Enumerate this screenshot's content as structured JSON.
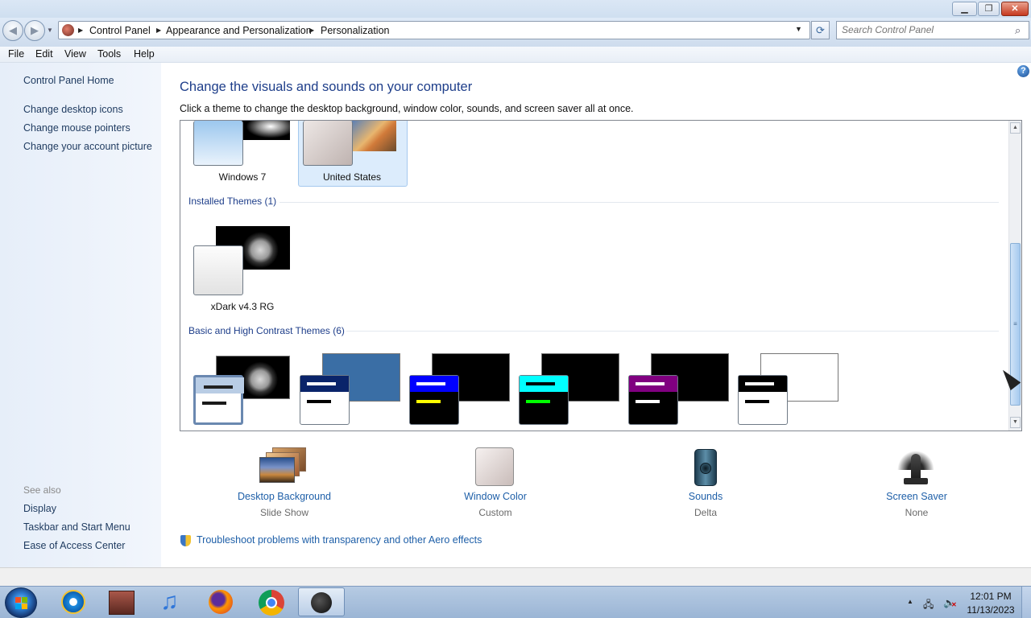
{
  "window": {
    "minimize_icon": "minimize-icon",
    "maximize_icon": "restore-icon",
    "close_glyph": "✕",
    "minimize_glyph": "▁",
    "restore_glyph": "❐"
  },
  "nav": {
    "back_glyph": "◀",
    "forward_glyph": "▶",
    "breadcrumbs": [
      "Control Panel",
      "Appearance and Personalization",
      "Personalization"
    ],
    "refresh_glyph": "⟳",
    "search_placeholder": "Search Control Panel",
    "search_glyph": "⌕"
  },
  "menu": [
    "File",
    "Edit",
    "View",
    "Tools",
    "Help"
  ],
  "left_pane": {
    "home": "Control Panel Home",
    "links": [
      "Change desktop icons",
      "Change mouse pointers",
      "Change your account picture"
    ],
    "see_also_label": "See also",
    "see_also": [
      "Display",
      "Taskbar and Start Menu",
      "Ease of Access Center"
    ]
  },
  "main": {
    "heading": "Change the visuals and sounds on your computer",
    "subtitle": "Click a theme to change the desktop background, window color, sounds, and screen saver all at once.",
    "help_glyph": "?",
    "aero_themes": [
      {
        "name": "Windows 7"
      },
      {
        "name": "United States",
        "selected": true
      }
    ],
    "installed_header": "Installed Themes (1)",
    "installed_themes": [
      {
        "name": "xDark v4.3 RG"
      }
    ],
    "basic_header": "Basic and High Contrast Themes (6)",
    "basic_themes": [
      {
        "big": "#000000",
        "small": "#b9cde5",
        "bar1": "#1a1a1a",
        "bar2": "#1a1a1a"
      },
      {
        "big": "#3a6ea5",
        "small": "#ffffff",
        "bar1": "#0a246a",
        "bar2": "#000000"
      },
      {
        "big": "#000000",
        "small": "#000000",
        "bar1": "#0000ff",
        "bar2": "#ffff00"
      },
      {
        "big": "#000000",
        "small": "#000000",
        "bar1": "#00ffff",
        "bar2": "#00ff00"
      },
      {
        "big": "#000000",
        "small": "#000000",
        "bar1": "#800080",
        "bar2": "#ffffff"
      },
      {
        "big": "#ffffff",
        "small": "#ffffff",
        "bar1": "#000000",
        "bar2": "#000000"
      }
    ],
    "tiles": [
      {
        "label": "Desktop Background",
        "sub": "Slide Show",
        "icon": "desktop-background-icon"
      },
      {
        "label": "Window Color",
        "sub": "Custom",
        "icon": "window-color-icon"
      },
      {
        "label": "Sounds",
        "sub": "Delta",
        "icon": "sounds-icon"
      },
      {
        "label": "Screen Saver",
        "sub": "None",
        "icon": "screen-saver-icon"
      }
    ],
    "trouble_link": "Troubleshoot problems with transparency and other Aero effects"
  },
  "taskbar": {
    "apps": [
      "internet-explorer-icon",
      "media-center-icon",
      "itunes-icon",
      "firefox-icon",
      "chrome-icon",
      "personalization-icon"
    ],
    "time": "12:01 PM",
    "date": "11/13/2023",
    "tray_up_glyph": "▲",
    "network_glyph": "🖧",
    "volume_glyph": "🔈"
  },
  "colors": {
    "link": "#1e5fa8",
    "heading": "#1e3e8a",
    "selection": "#dcecfc"
  }
}
